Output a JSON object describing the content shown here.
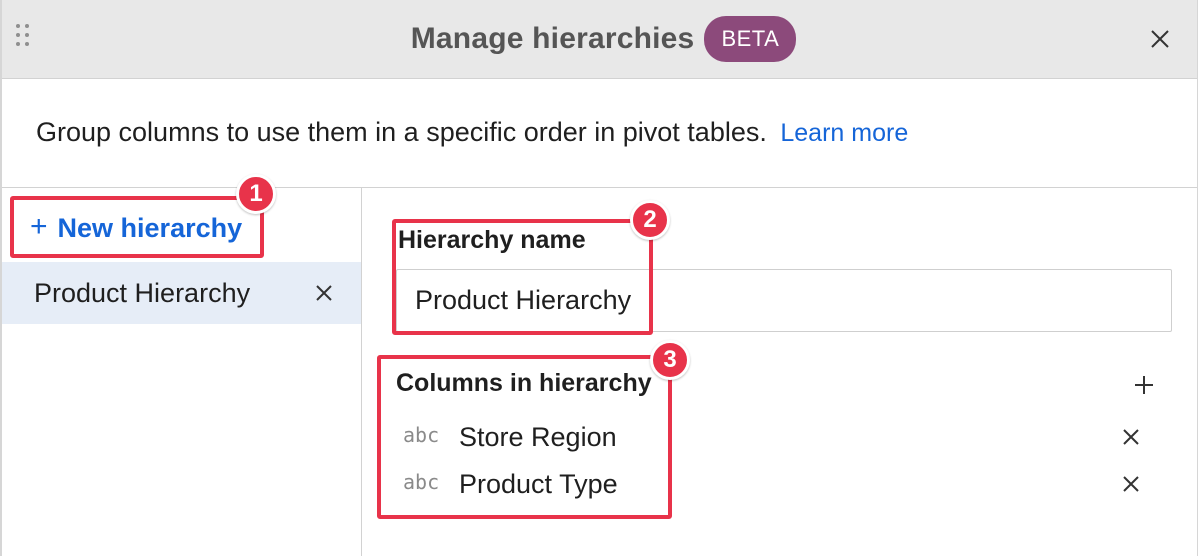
{
  "dialog": {
    "title": "Manage hierarchies",
    "badge": "BETA",
    "description": "Group columns to use them in a specific order in pivot tables.",
    "learn_more": "Learn more"
  },
  "sidebar": {
    "new_hierarchy": "New hierarchy",
    "items": [
      {
        "label": "Product Hierarchy"
      }
    ]
  },
  "form": {
    "name_label": "Hierarchy name",
    "name_value": "Product Hierarchy",
    "columns_label": "Columns in hierarchy",
    "columns": [
      {
        "type": "abc",
        "name": "Store Region"
      },
      {
        "type": "abc",
        "name": "Product Type"
      }
    ]
  },
  "callouts": [
    "1",
    "2",
    "3"
  ],
  "colors": {
    "header_bg": "#e8e8e8",
    "beta_bg": "#8c4a7b",
    "link": "#1565d8",
    "selected_item_bg": "#e6edf7",
    "callout": "#e8334a"
  },
  "icons": [
    "drag-handle-icon",
    "close-icon",
    "plus-icon",
    "remove-icon"
  ]
}
